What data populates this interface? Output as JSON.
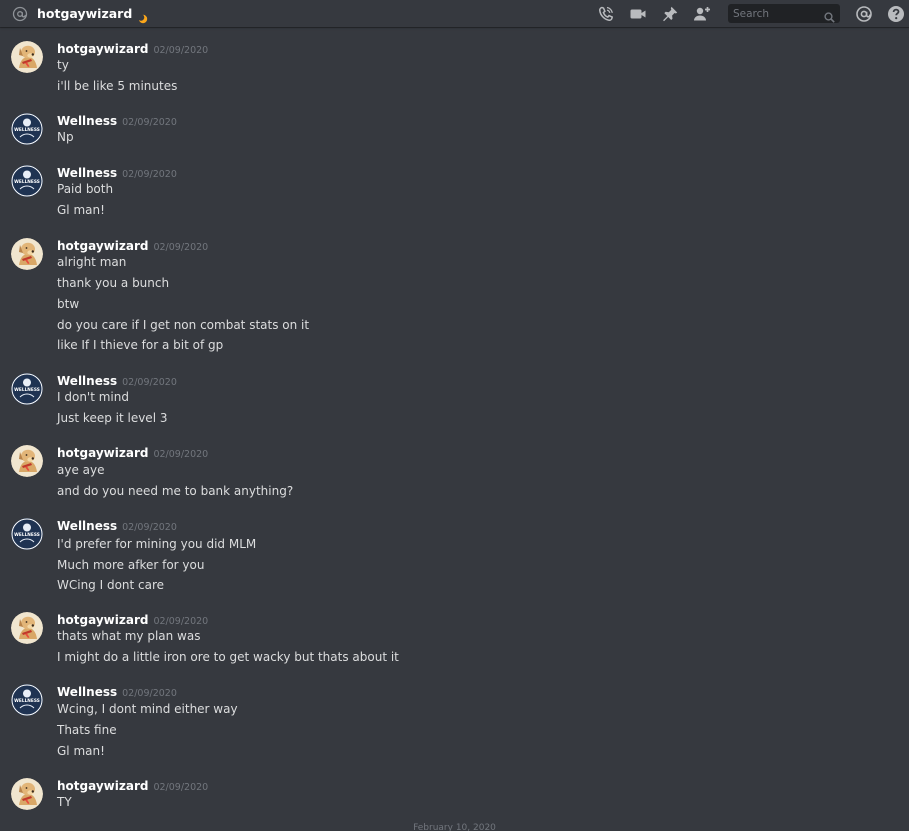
{
  "header": {
    "channel_name": "hotgaywizard",
    "search_placeholder": "Search",
    "icons": [
      "at-sign-icon",
      "moon-status-icon",
      "call-icon",
      "video-icon",
      "pin-icon",
      "add-friend-icon",
      "search-icon",
      "mention-icon",
      "help-icon"
    ]
  },
  "messages": [
    {
      "author": "hotgaywizard",
      "avatar": "dog-avatar",
      "timestamp": "02/09/2020",
      "lines": [
        "ty",
        "i'll be like 5 minutes"
      ]
    },
    {
      "author": "Wellness",
      "avatar": "wellness-logo-avatar",
      "avatar_text": "WELLNESS",
      "timestamp": "02/09/2020",
      "lines": [
        "Np"
      ]
    },
    {
      "author": "Wellness",
      "avatar": "wellness-logo-avatar",
      "avatar_text": "WELLNESS",
      "timestamp": "02/09/2020",
      "lines": [
        "Paid both",
        "Gl man!"
      ]
    },
    {
      "author": "hotgaywizard",
      "avatar": "dog-avatar",
      "timestamp": "02/09/2020",
      "lines": [
        "alright man",
        "thank you a bunch",
        "btw",
        "do you care if I get non combat stats on it",
        "like If I thieve for a bit of gp"
      ]
    },
    {
      "author": "Wellness",
      "avatar": "wellness-logo-avatar",
      "avatar_text": "WELLNESS",
      "timestamp": "02/09/2020",
      "lines": [
        "I don't mind",
        "Just keep it level 3"
      ]
    },
    {
      "author": "hotgaywizard",
      "avatar": "dog-avatar",
      "timestamp": "02/09/2020",
      "lines": [
        "aye aye",
        "and do you need me to bank anything?"
      ]
    },
    {
      "author": "Wellness",
      "avatar": "wellness-logo-avatar",
      "avatar_text": "WELLNESS",
      "timestamp": "02/09/2020",
      "lines": [
        "I'd prefer for mining you did MLM",
        "Much more afker for you",
        "WCing I dont care"
      ]
    },
    {
      "author": "hotgaywizard",
      "avatar": "dog-avatar",
      "timestamp": "02/09/2020",
      "lines": [
        "thats what my plan was",
        "I might do a little iron ore to get wacky but thats about it"
      ]
    },
    {
      "author": "Wellness",
      "avatar": "wellness-logo-avatar",
      "avatar_text": "WELLNESS",
      "timestamp": "02/09/2020",
      "lines": [
        "Wcing, I dont mind either way",
        "Thats fine",
        "Gl man!"
      ]
    },
    {
      "author": "hotgaywizard",
      "avatar": "dog-avatar",
      "timestamp": "02/09/2020",
      "lines": [
        "TY"
      ]
    }
  ],
  "date_divider": "February 10, 2020",
  "colors": {
    "background": "#36393f",
    "author": "#ffffff",
    "text": "#dcddde",
    "timestamp": "#72767d",
    "search_bg": "#202225",
    "icon": "#b9bbbe"
  }
}
